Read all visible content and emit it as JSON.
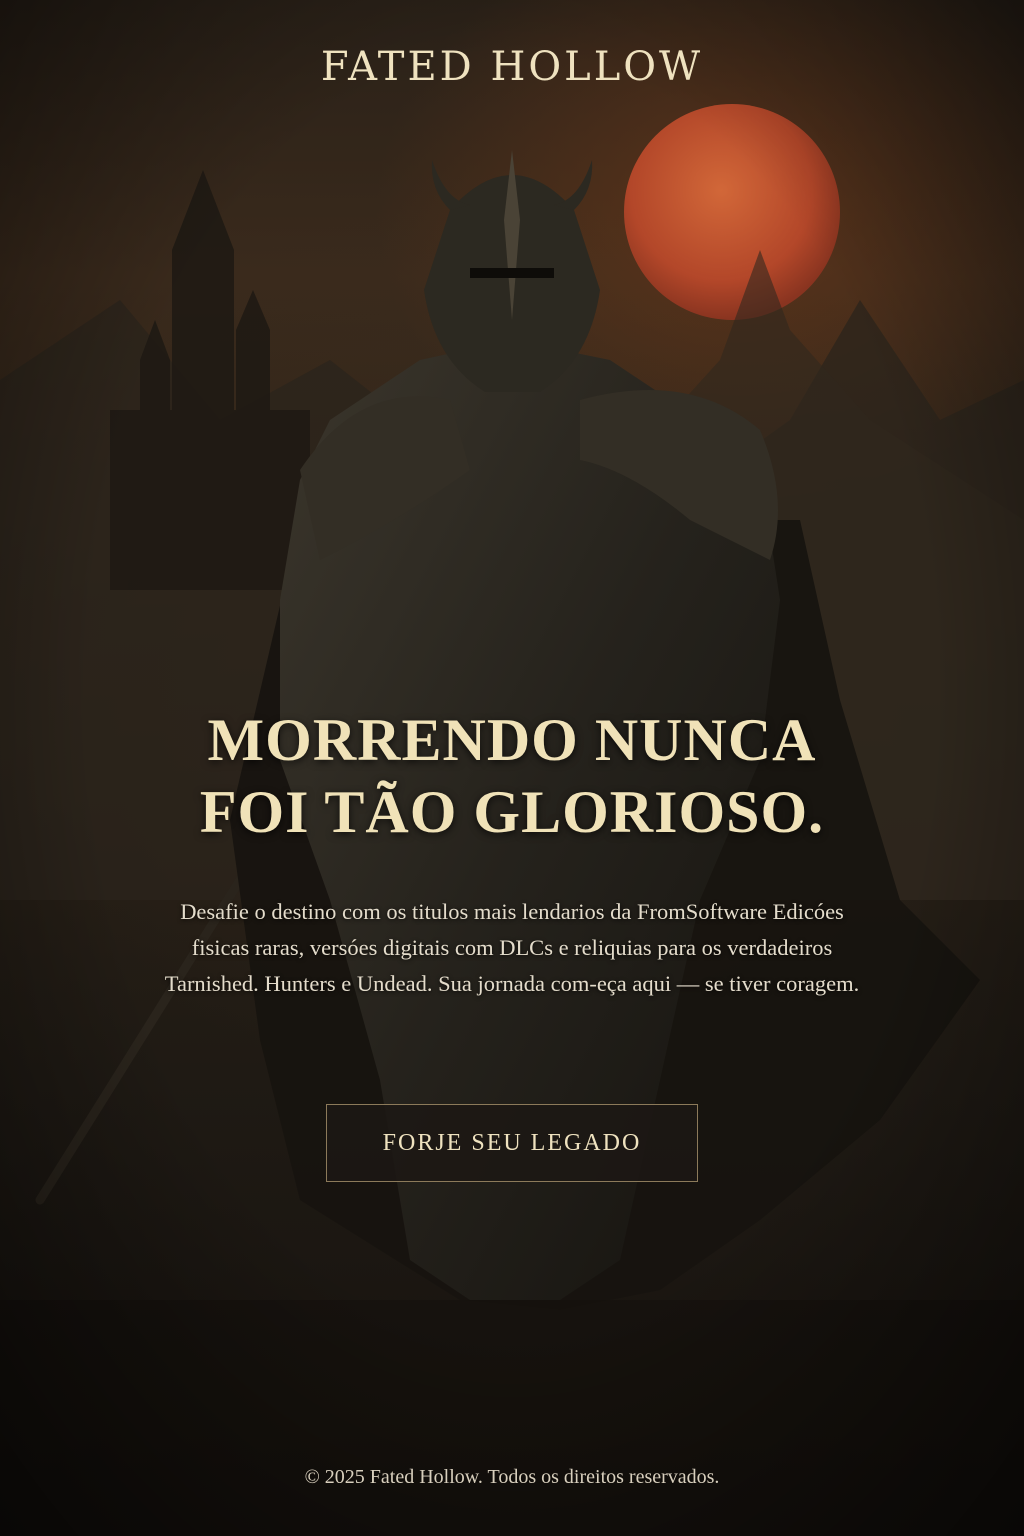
{
  "brand": {
    "name": "FATED HOLLOW"
  },
  "hero": {
    "headline_line1": "MORRENDO NUNCA",
    "headline_line2": "FOI TÃO GLORIOSO.",
    "description": "Desafie o destino com os titulos mais lendarios da FromSoftware Edicóes fisicas raras, versóes digitais com DLCs e reliquias para os verdadeiros Tarnished. Hunters e Undead. Sua jornada com-eça aqui — se tiver coragem.",
    "cta_label": "FORJE SEU LEGADO"
  },
  "footer": {
    "copyright": "© 2025 Fated Hollow. Todos os direitos reservados."
  },
  "colors": {
    "background": "#1f1a14",
    "moon": "#c4552a",
    "text_primary": "#efe2bf",
    "button_border": "#8c7a5a"
  },
  "icons": {
    "hero_art": "armored-knight-illustration"
  }
}
